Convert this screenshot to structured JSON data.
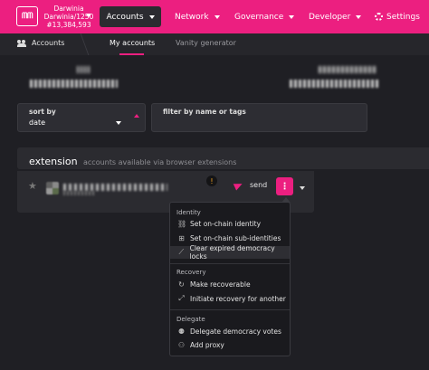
{
  "topbar": {
    "logo_text": "ᗰᗰ",
    "chain_name": "Darwinia",
    "chain_version": "Darwinia/1250",
    "block_number": "#13,384,593",
    "nav": [
      {
        "label": "Accounts"
      },
      {
        "label": "Network"
      },
      {
        "label": "Governance"
      },
      {
        "label": "Developer"
      },
      {
        "label": "Settings"
      }
    ],
    "colors": {
      "brand": "#ec1f80",
      "active_tab": "#2b2b30"
    }
  },
  "subnav": {
    "section": "Accounts",
    "tabs": [
      {
        "label": "My accounts",
        "active": true
      },
      {
        "label": "Vanity generator",
        "active": false
      }
    ]
  },
  "filters": {
    "sort_label": "sort by",
    "sort_value": "date",
    "filter_label": "filter by name or tags"
  },
  "extension": {
    "title": "extension",
    "subtitle": "accounts available via browser extensions",
    "account": {
      "send_label": "send",
      "more_icon": "⋮",
      "warning_icon": "!"
    }
  },
  "menu": {
    "groups": [
      {
        "title": "Identity",
        "items": [
          {
            "label": "Set on-chain identity",
            "icon": "🔗"
          },
          {
            "label": "Set on-chain sub-identities",
            "icon": "⊞"
          },
          {
            "label": "Clear expired democracy locks",
            "icon": "⟋"
          }
        ]
      },
      {
        "title": "Recovery",
        "items": [
          {
            "label": "Make recoverable",
            "icon": "↻"
          },
          {
            "label": "Initiate recovery for another",
            "icon": "⤢"
          }
        ]
      },
      {
        "title": "Delegate",
        "items": [
          {
            "label": "Delegate democracy votes",
            "icon": "👤"
          },
          {
            "label": "Add proxy",
            "icon": "👥"
          }
        ]
      }
    ]
  }
}
